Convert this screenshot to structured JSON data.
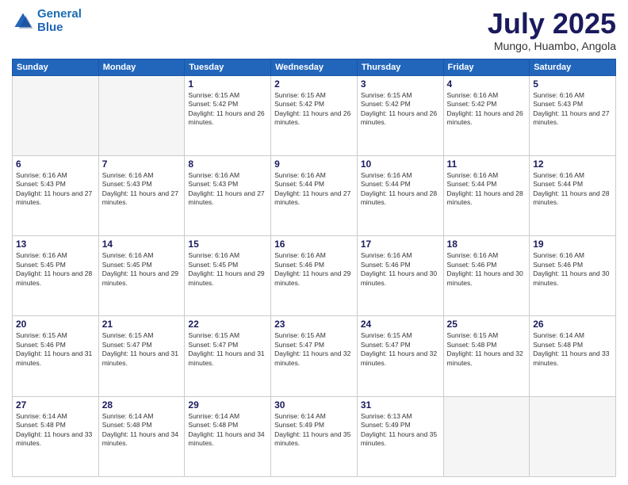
{
  "logo": {
    "line1": "General",
    "line2": "Blue"
  },
  "title": "July 2025",
  "location": "Mungo, Huambo, Angola",
  "weekdays": [
    "Sunday",
    "Monday",
    "Tuesday",
    "Wednesday",
    "Thursday",
    "Friday",
    "Saturday"
  ],
  "weeks": [
    [
      {
        "day": "",
        "text": ""
      },
      {
        "day": "",
        "text": ""
      },
      {
        "day": "1",
        "text": "Sunrise: 6:15 AM\nSunset: 5:42 PM\nDaylight: 11 hours and 26 minutes."
      },
      {
        "day": "2",
        "text": "Sunrise: 6:15 AM\nSunset: 5:42 PM\nDaylight: 11 hours and 26 minutes."
      },
      {
        "day": "3",
        "text": "Sunrise: 6:15 AM\nSunset: 5:42 PM\nDaylight: 11 hours and 26 minutes."
      },
      {
        "day": "4",
        "text": "Sunrise: 6:16 AM\nSunset: 5:42 PM\nDaylight: 11 hours and 26 minutes."
      },
      {
        "day": "5",
        "text": "Sunrise: 6:16 AM\nSunset: 5:43 PM\nDaylight: 11 hours and 27 minutes."
      }
    ],
    [
      {
        "day": "6",
        "text": "Sunrise: 6:16 AM\nSunset: 5:43 PM\nDaylight: 11 hours and 27 minutes."
      },
      {
        "day": "7",
        "text": "Sunrise: 6:16 AM\nSunset: 5:43 PM\nDaylight: 11 hours and 27 minutes."
      },
      {
        "day": "8",
        "text": "Sunrise: 6:16 AM\nSunset: 5:43 PM\nDaylight: 11 hours and 27 minutes."
      },
      {
        "day": "9",
        "text": "Sunrise: 6:16 AM\nSunset: 5:44 PM\nDaylight: 11 hours and 27 minutes."
      },
      {
        "day": "10",
        "text": "Sunrise: 6:16 AM\nSunset: 5:44 PM\nDaylight: 11 hours and 28 minutes."
      },
      {
        "day": "11",
        "text": "Sunrise: 6:16 AM\nSunset: 5:44 PM\nDaylight: 11 hours and 28 minutes."
      },
      {
        "day": "12",
        "text": "Sunrise: 6:16 AM\nSunset: 5:44 PM\nDaylight: 11 hours and 28 minutes."
      }
    ],
    [
      {
        "day": "13",
        "text": "Sunrise: 6:16 AM\nSunset: 5:45 PM\nDaylight: 11 hours and 28 minutes."
      },
      {
        "day": "14",
        "text": "Sunrise: 6:16 AM\nSunset: 5:45 PM\nDaylight: 11 hours and 29 minutes."
      },
      {
        "day": "15",
        "text": "Sunrise: 6:16 AM\nSunset: 5:45 PM\nDaylight: 11 hours and 29 minutes."
      },
      {
        "day": "16",
        "text": "Sunrise: 6:16 AM\nSunset: 5:46 PM\nDaylight: 11 hours and 29 minutes."
      },
      {
        "day": "17",
        "text": "Sunrise: 6:16 AM\nSunset: 5:46 PM\nDaylight: 11 hours and 30 minutes."
      },
      {
        "day": "18",
        "text": "Sunrise: 6:16 AM\nSunset: 5:46 PM\nDaylight: 11 hours and 30 minutes."
      },
      {
        "day": "19",
        "text": "Sunrise: 6:16 AM\nSunset: 5:46 PM\nDaylight: 11 hours and 30 minutes."
      }
    ],
    [
      {
        "day": "20",
        "text": "Sunrise: 6:15 AM\nSunset: 5:46 PM\nDaylight: 11 hours and 31 minutes."
      },
      {
        "day": "21",
        "text": "Sunrise: 6:15 AM\nSunset: 5:47 PM\nDaylight: 11 hours and 31 minutes."
      },
      {
        "day": "22",
        "text": "Sunrise: 6:15 AM\nSunset: 5:47 PM\nDaylight: 11 hours and 31 minutes."
      },
      {
        "day": "23",
        "text": "Sunrise: 6:15 AM\nSunset: 5:47 PM\nDaylight: 11 hours and 32 minutes."
      },
      {
        "day": "24",
        "text": "Sunrise: 6:15 AM\nSunset: 5:47 PM\nDaylight: 11 hours and 32 minutes."
      },
      {
        "day": "25",
        "text": "Sunrise: 6:15 AM\nSunset: 5:48 PM\nDaylight: 11 hours and 32 minutes."
      },
      {
        "day": "26",
        "text": "Sunrise: 6:14 AM\nSunset: 5:48 PM\nDaylight: 11 hours and 33 minutes."
      }
    ],
    [
      {
        "day": "27",
        "text": "Sunrise: 6:14 AM\nSunset: 5:48 PM\nDaylight: 11 hours and 33 minutes."
      },
      {
        "day": "28",
        "text": "Sunrise: 6:14 AM\nSunset: 5:48 PM\nDaylight: 11 hours and 34 minutes."
      },
      {
        "day": "29",
        "text": "Sunrise: 6:14 AM\nSunset: 5:48 PM\nDaylight: 11 hours and 34 minutes."
      },
      {
        "day": "30",
        "text": "Sunrise: 6:14 AM\nSunset: 5:49 PM\nDaylight: 11 hours and 35 minutes."
      },
      {
        "day": "31",
        "text": "Sunrise: 6:13 AM\nSunset: 5:49 PM\nDaylight: 11 hours and 35 minutes."
      },
      {
        "day": "",
        "text": ""
      },
      {
        "day": "",
        "text": ""
      }
    ]
  ]
}
